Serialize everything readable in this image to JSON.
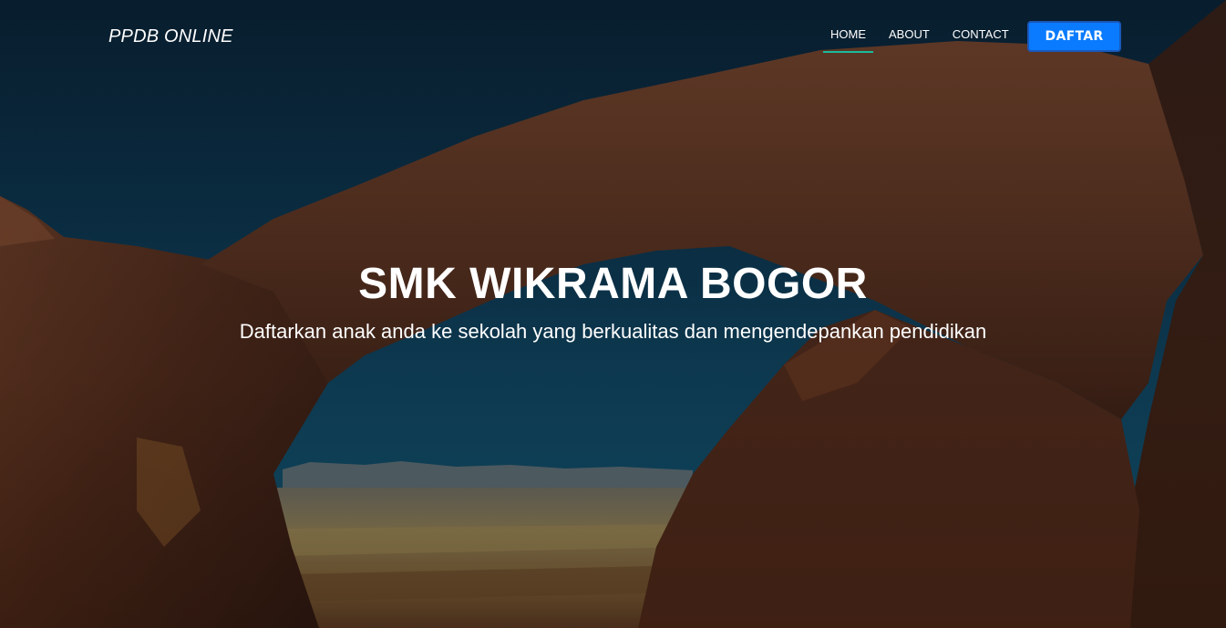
{
  "navbar": {
    "brand": "PPDB ONLINE",
    "links": [
      {
        "label": "HOME",
        "active": true
      },
      {
        "label": "ABOUT",
        "active": false
      },
      {
        "label": "CONTACT",
        "active": false
      }
    ],
    "cta_label": "DAFTAR"
  },
  "hero": {
    "title": "SMK WIKRAMA BOGOR",
    "subtitle": "Daftarkan anak anda ke sekolah yang berkualitas dan mengendepankan pendidikan"
  },
  "colors": {
    "accent_underline": "#1abc9c",
    "cta_background": "#0a7bff",
    "cta_border": "#1b57b8",
    "text": "#ffffff"
  }
}
